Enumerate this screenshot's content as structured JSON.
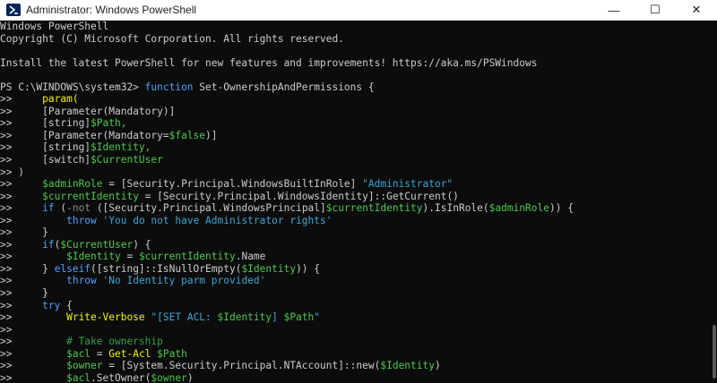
{
  "window": {
    "title": "Administrator: Windows PowerShell",
    "minimize_glyph": "—",
    "maximize_glyph": "☐",
    "close_glyph": "✕"
  },
  "icons": [
    "powershell-icon"
  ],
  "colors": {
    "background": "#0c0c0c",
    "default": "#cccccc",
    "keyword": "#4ea1ff",
    "type": "#cccccc",
    "variable": "#4ec84e",
    "string": "#3aa6d6",
    "command": "#f2f200",
    "operator": "#8a8a8a",
    "comment": "#2ea043",
    "prompt": "#cccccc"
  },
  "console_lines": [
    [
      {
        "t": "Windows PowerShell",
        "c": "default"
      }
    ],
    [
      {
        "t": "Copyright (C) Microsoft Corporation. All rights reserved.",
        "c": "default"
      }
    ],
    [],
    [
      {
        "t": "Install the latest PowerShell for new features and improvements! https://aka.ms/PSWindows",
        "c": "default"
      }
    ],
    [],
    [
      {
        "t": "PS C:\\WINDOWS\\system32> ",
        "c": "prompt"
      },
      {
        "t": "function",
        "c": "keyword"
      },
      {
        "t": " Set-OwnershipAndPermissions {",
        "c": "default"
      }
    ],
    [
      {
        "t": ">>     ",
        "c": "prompt"
      },
      {
        "t": "param(",
        "c": "command"
      }
    ],
    [
      {
        "t": ">>     ",
        "c": "prompt"
      },
      {
        "t": "[Parameter(Mandatory)]",
        "c": "default"
      }
    ],
    [
      {
        "t": ">>     ",
        "c": "prompt"
      },
      {
        "t": "[string]",
        "c": "default"
      },
      {
        "t": "$Path,",
        "c": "variable"
      }
    ],
    [
      {
        "t": ">>     ",
        "c": "prompt"
      },
      {
        "t": "[Parameter(Mandatory=",
        "c": "default"
      },
      {
        "t": "$false",
        "c": "variable"
      },
      {
        "t": ")]",
        "c": "default"
      }
    ],
    [
      {
        "t": ">>     ",
        "c": "prompt"
      },
      {
        "t": "[string]",
        "c": "default"
      },
      {
        "t": "$Identity,",
        "c": "variable"
      }
    ],
    [
      {
        "t": ">>     ",
        "c": "prompt"
      },
      {
        "t": "[switch]",
        "c": "default"
      },
      {
        "t": "$CurrentUser",
        "c": "variable"
      }
    ],
    [
      {
        "t": ">> )",
        "c": "prompt"
      }
    ],
    [
      {
        "t": ">>     ",
        "c": "prompt"
      },
      {
        "t": "$adminRole",
        "c": "variable"
      },
      {
        "t": " = [Security.Principal.WindowsBuiltInRole] ",
        "c": "default"
      },
      {
        "t": "\"Administrator\"",
        "c": "string"
      }
    ],
    [
      {
        "t": ">>     ",
        "c": "prompt"
      },
      {
        "t": "$currentIdentity",
        "c": "variable"
      },
      {
        "t": " = [Security.Principal.WindowsIdentity]::GetCurrent()",
        "c": "default"
      }
    ],
    [
      {
        "t": ">>     ",
        "c": "prompt"
      },
      {
        "t": "if",
        "c": "keyword"
      },
      {
        "t": " (",
        "c": "default"
      },
      {
        "t": "-not",
        "c": "operator"
      },
      {
        "t": " ([Security.Principal.WindowsPrincipal]",
        "c": "default"
      },
      {
        "t": "$currentIdentity",
        "c": "variable"
      },
      {
        "t": ").IsInRole(",
        "c": "default"
      },
      {
        "t": "$adminRole",
        "c": "variable"
      },
      {
        "t": ")) {",
        "c": "default"
      }
    ],
    [
      {
        "t": ">>         ",
        "c": "prompt"
      },
      {
        "t": "throw",
        "c": "keyword"
      },
      {
        "t": " ",
        "c": "default"
      },
      {
        "t": "'You do not have Administrator rights'",
        "c": "string"
      }
    ],
    [
      {
        "t": ">>     }",
        "c": "prompt"
      }
    ],
    [
      {
        "t": ">>     ",
        "c": "prompt"
      },
      {
        "t": "if",
        "c": "keyword"
      },
      {
        "t": "(",
        "c": "default"
      },
      {
        "t": "$CurrentUser",
        "c": "variable"
      },
      {
        "t": ") {",
        "c": "default"
      }
    ],
    [
      {
        "t": ">>         ",
        "c": "prompt"
      },
      {
        "t": "$Identity",
        "c": "variable"
      },
      {
        "t": " = ",
        "c": "default"
      },
      {
        "t": "$currentIdentity",
        "c": "variable"
      },
      {
        "t": ".Name",
        "c": "default"
      }
    ],
    [
      {
        "t": ">>     } ",
        "c": "prompt"
      },
      {
        "t": "elseif",
        "c": "keyword"
      },
      {
        "t": "([string]::IsNullOrEmpty(",
        "c": "default"
      },
      {
        "t": "$Identity",
        "c": "variable"
      },
      {
        "t": ")) {",
        "c": "default"
      }
    ],
    [
      {
        "t": ">>         ",
        "c": "prompt"
      },
      {
        "t": "throw",
        "c": "keyword"
      },
      {
        "t": " ",
        "c": "default"
      },
      {
        "t": "'No Identity parm provided'",
        "c": "string"
      }
    ],
    [
      {
        "t": ">>     }",
        "c": "prompt"
      }
    ],
    [
      {
        "t": ">>     ",
        "c": "prompt"
      },
      {
        "t": "try",
        "c": "keyword"
      },
      {
        "t": " {",
        "c": "default"
      }
    ],
    [
      {
        "t": ">>         ",
        "c": "prompt"
      },
      {
        "t": "Write-Verbose",
        "c": "command"
      },
      {
        "t": " ",
        "c": "default"
      },
      {
        "t": "\"[SET ACL: ",
        "c": "string"
      },
      {
        "t": "$Identity",
        "c": "variable"
      },
      {
        "t": "] ",
        "c": "string"
      },
      {
        "t": "$Path",
        "c": "variable"
      },
      {
        "t": "\"",
        "c": "string"
      }
    ],
    [
      {
        "t": ">>",
        "c": "prompt"
      }
    ],
    [
      {
        "t": ">>         ",
        "c": "prompt"
      },
      {
        "t": "# Take ownership",
        "c": "comment"
      }
    ],
    [
      {
        "t": ">>         ",
        "c": "prompt"
      },
      {
        "t": "$acl",
        "c": "variable"
      },
      {
        "t": " = ",
        "c": "default"
      },
      {
        "t": "Get-Acl",
        "c": "command"
      },
      {
        "t": " ",
        "c": "default"
      },
      {
        "t": "$Path",
        "c": "variable"
      }
    ],
    [
      {
        "t": ">>         ",
        "c": "prompt"
      },
      {
        "t": "$owner",
        "c": "variable"
      },
      {
        "t": " = [System.Security.Principal.NTAccount]::new(",
        "c": "default"
      },
      {
        "t": "$Identity",
        "c": "variable"
      },
      {
        "t": ")",
        "c": "default"
      }
    ],
    [
      {
        "t": ">>         ",
        "c": "prompt"
      },
      {
        "t": "$acl",
        "c": "variable"
      },
      {
        "t": ".SetOwner(",
        "c": "default"
      },
      {
        "t": "$owner",
        "c": "variable"
      },
      {
        "t": ")",
        "c": "default"
      }
    ]
  ]
}
